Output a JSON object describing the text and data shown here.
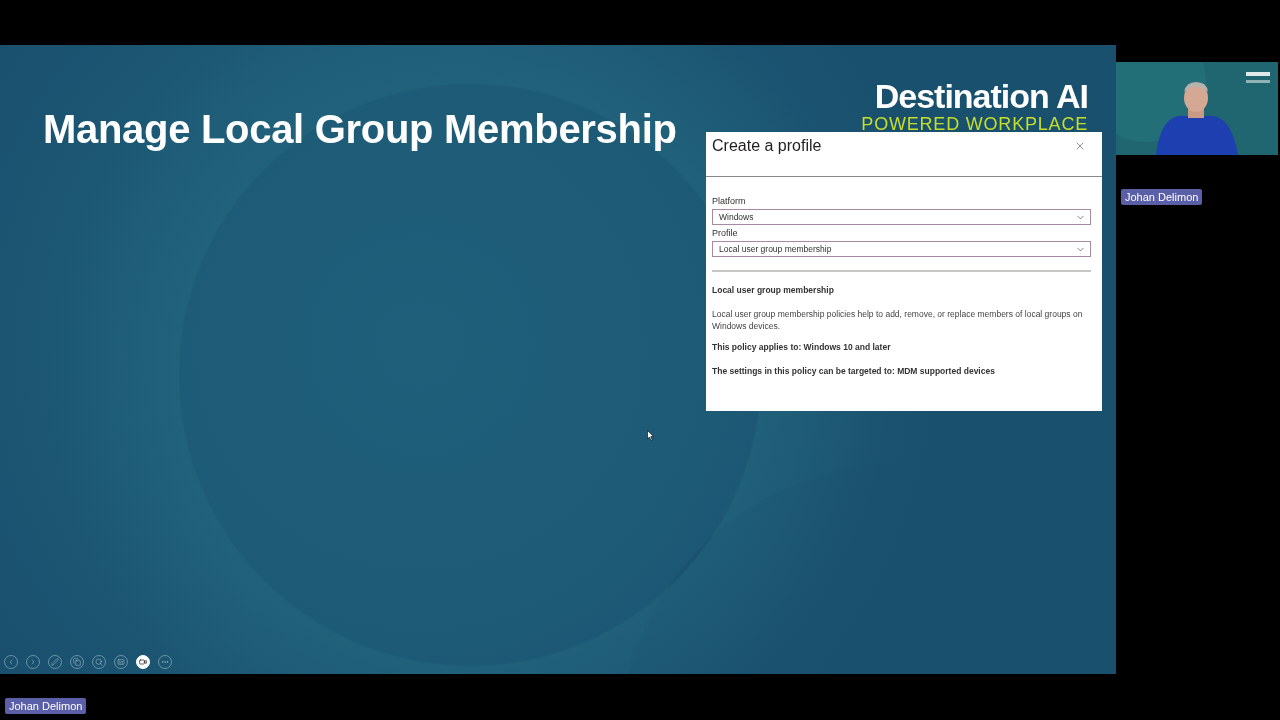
{
  "slide": {
    "title": "Manage Local Group Membership",
    "logo": {
      "name": "Destination AI",
      "tagline": "POWERED WORKPLACE"
    }
  },
  "dialog": {
    "title": "Create a profile",
    "fields": [
      {
        "label": "Platform",
        "value": "Windows"
      },
      {
        "label": "Profile",
        "value": "Local user group membership"
      }
    ],
    "details": [
      {
        "kind": "heading",
        "text": "Local user group membership"
      },
      {
        "kind": "body",
        "text": "Local user group membership policies help to add, remove, or replace members of local groups on Windows devices."
      },
      {
        "kind": "emphasis",
        "text": "This policy applies to: Windows 10 and later"
      },
      {
        "kind": "emphasis",
        "text": "The settings in this policy can be targeted to: MDM supported devices"
      }
    ]
  },
  "slideshow_controls": [
    {
      "kind": "previous",
      "selected": false
    },
    {
      "kind": "next",
      "selected": false
    },
    {
      "kind": "pen",
      "selected": false
    },
    {
      "kind": "slides",
      "selected": false
    },
    {
      "kind": "zoom",
      "selected": false
    },
    {
      "kind": "subtitles",
      "selected": false
    },
    {
      "kind": "camera",
      "selected": true
    },
    {
      "kind": "more",
      "selected": false
    }
  ],
  "speaker_panel": {
    "kind": "picture",
    "name": "Johan Delimon"
  },
  "presenter_tag": {
    "name": "Johan Delimon"
  }
}
